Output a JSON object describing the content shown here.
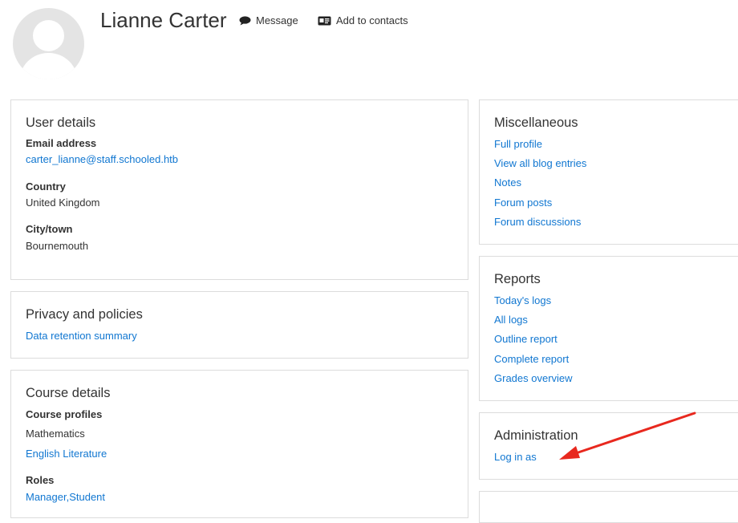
{
  "profile": {
    "name": "Lianne Carter",
    "actions": {
      "message_label": "Message",
      "contacts_label": "Add to contacts"
    }
  },
  "user_details": {
    "title": "User details",
    "email_label": "Email address",
    "email_value": "carter_lianne@staff.schooled.htb",
    "country_label": "Country",
    "country_value": "United Kingdom",
    "city_label": "City/town",
    "city_value": "Bournemouth"
  },
  "privacy": {
    "title": "Privacy and policies",
    "links": [
      "Data retention summary"
    ]
  },
  "course_details": {
    "title": "Course details",
    "profiles_label": "Course profiles",
    "courses": [
      "Mathematics",
      "English Literature"
    ],
    "roles_label": "Roles",
    "roles_value": "Manager,Student"
  },
  "miscellaneous": {
    "title": "Miscellaneous",
    "links": [
      "Full profile",
      "View all blog entries",
      "Notes",
      "Forum posts",
      "Forum discussions"
    ]
  },
  "reports": {
    "title": "Reports",
    "links": [
      "Today's logs",
      "All logs",
      "Outline report",
      "Complete report",
      "Grades overview"
    ]
  },
  "administration": {
    "title": "Administration",
    "links": [
      "Log in as"
    ]
  },
  "annotation": {
    "arrow_color": "#e8281e"
  }
}
